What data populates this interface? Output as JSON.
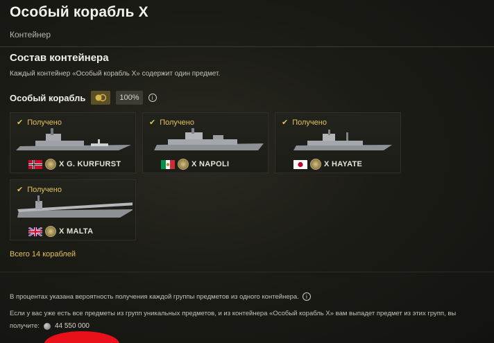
{
  "header": {
    "title": "Особый корабль X",
    "subtitle": "Контейнер"
  },
  "section": {
    "title": "Состав контейнера",
    "description": "Каждый контейнер «Особый корабль X» содержит один предмет."
  },
  "group": {
    "title": "Особый корабль",
    "percent": "100%",
    "icon": "ship-group-icon"
  },
  "ships": [
    {
      "status": "Получено",
      "tier": "X",
      "name": "G. KURFURST",
      "label": "X G. KURFURST",
      "nation": "Germany",
      "flag_colors": [
        "#c8102e",
        "#ffffff",
        "#000000"
      ]
    },
    {
      "status": "Получено",
      "tier": "X",
      "name": "NAPOLI",
      "label": "X NAPOLI",
      "nation": "Italy",
      "flag_colors": [
        "#009246",
        "#ffffff",
        "#ce2b37"
      ]
    },
    {
      "status": "Получено",
      "tier": "X",
      "name": "HAYATE",
      "label": "X HAYATE",
      "nation": "Japan",
      "flag_colors": [
        "#ffffff",
        "#bc002d"
      ]
    },
    {
      "status": "Получено",
      "tier": "X",
      "name": "MALTA",
      "label": "X MALTA",
      "nation": "United Kingdom",
      "flag_colors": [
        "#012169",
        "#ffffff",
        "#c8102e"
      ]
    }
  ],
  "total_link": "Всего 14 кораблей",
  "notes": {
    "probability": "В процентах указана вероятность получения каждой группы предметов из одного контейнера.",
    "duplicate": "Если у вас уже есть все предметы из групп уникальных предметов, и из контейнера «Особый корабль X» вам выпадет предмет из этих групп, вы",
    "receive_label": "получите:",
    "credits": "44 550 000"
  },
  "colors": {
    "accent": "#e3c15a",
    "background": "#1c1c16",
    "card": "#23231d"
  }
}
